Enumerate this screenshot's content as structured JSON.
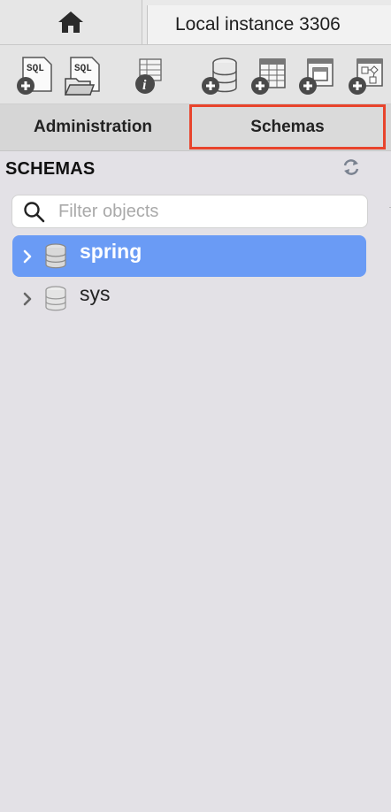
{
  "header": {
    "home_icon": "home-icon",
    "instance_tab_label": "Local instance 3306"
  },
  "toolbar": {
    "buttons": [
      {
        "icon": "new-sql-tab-icon",
        "text": "SQL"
      },
      {
        "icon": "open-sql-script-icon",
        "text": "SQL"
      },
      {
        "icon": "inspector-info-icon"
      },
      {
        "icon": "create-schema-icon"
      },
      {
        "icon": "create-table-icon"
      },
      {
        "icon": "create-view-icon"
      },
      {
        "icon": "create-procedure-icon"
      }
    ]
  },
  "tabs": {
    "administration": "Administration",
    "schemas": "Schemas",
    "active": "Schemas",
    "highlight_color": "#e8442c"
  },
  "schemas_panel": {
    "heading": "SCHEMAS",
    "refresh_icon": "refresh-icon",
    "filter_placeholder": "Filter objects",
    "filter_value": "",
    "items": [
      {
        "label": "spring",
        "selected": true
      },
      {
        "label": "sys",
        "selected": false
      }
    ],
    "selection_color": "#6a9bf5"
  }
}
